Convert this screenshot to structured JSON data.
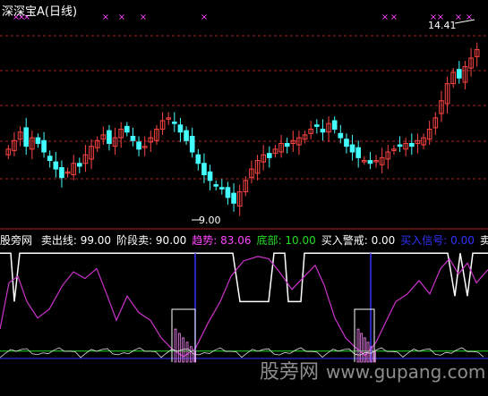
{
  "title": {
    "name": "深深宝A",
    "period": "(日线)"
  },
  "price_labels": {
    "high": "14.41",
    "low": "9.00"
  },
  "indicator": {
    "name": "股旁网",
    "items": [
      {
        "label": "卖出线:",
        "value": "99.00",
        "color": "#ffffff"
      },
      {
        "label": "阶段卖:",
        "value": "90.00",
        "color": "#ffffff"
      },
      {
        "label": "趋势:",
        "value": "83.06",
        "color": "#ff44ff"
      },
      {
        "label": "底部:",
        "value": "10.00",
        "color": "#22dd22"
      },
      {
        "label": "买入警戒:",
        "value": "0.00",
        "color": "#ffffff"
      },
      {
        "label": "买入信号:",
        "value": "0.00",
        "color": "#3333ff"
      },
      {
        "label": "卖出警",
        "value": "",
        "color": "#ffffff"
      }
    ]
  },
  "watermark": {
    "text": "股旁网",
    "url": "www.gupang.com"
  },
  "colors": {
    "background": "#000000",
    "up_candle": "#ff4444",
    "down_candle": "#44ffff",
    "grid": "#aa2222",
    "signal_marker": "#ff44ff",
    "trend_line": "#cc33cc",
    "sell_line": "#ffffff",
    "bottom_line": "#22dd22",
    "buy_line": "#3333ff"
  },
  "chart_data": {
    "type": "candlestick",
    "title": "深深宝A (日线)",
    "high_label": 14.41,
    "low_label": 9.0,
    "close_series": [
      10.9,
      11.2,
      11.5,
      11.0,
      11.3,
      11.1,
      10.8,
      10.5,
      10.2,
      9.9,
      10.1,
      10.4,
      10.3,
      10.7,
      11.0,
      11.2,
      11.4,
      11.1,
      11.3,
      11.6,
      11.5,
      11.2,
      10.9,
      11.0,
      11.3,
      11.6,
      11.9,
      12.0,
      11.8,
      11.5,
      11.2,
      10.8,
      10.4,
      10.0,
      9.8,
      9.6,
      9.5,
      9.2,
      9.0,
      9.4,
      9.8,
      10.2,
      10.5,
      10.7,
      10.6,
      10.9,
      11.1,
      11.0,
      11.2,
      11.3,
      11.4,
      11.6,
      11.7,
      11.5,
      11.8,
      11.6,
      11.3,
      11.0,
      10.8,
      10.6,
      10.5,
      10.4,
      10.5,
      10.6,
      10.8,
      10.9,
      11.0,
      11.1,
      11.0,
      11.2,
      11.3,
      11.6,
      12.0,
      12.6,
      13.2,
      13.6,
      13.4,
      13.8,
      14.1,
      14.4
    ]
  }
}
